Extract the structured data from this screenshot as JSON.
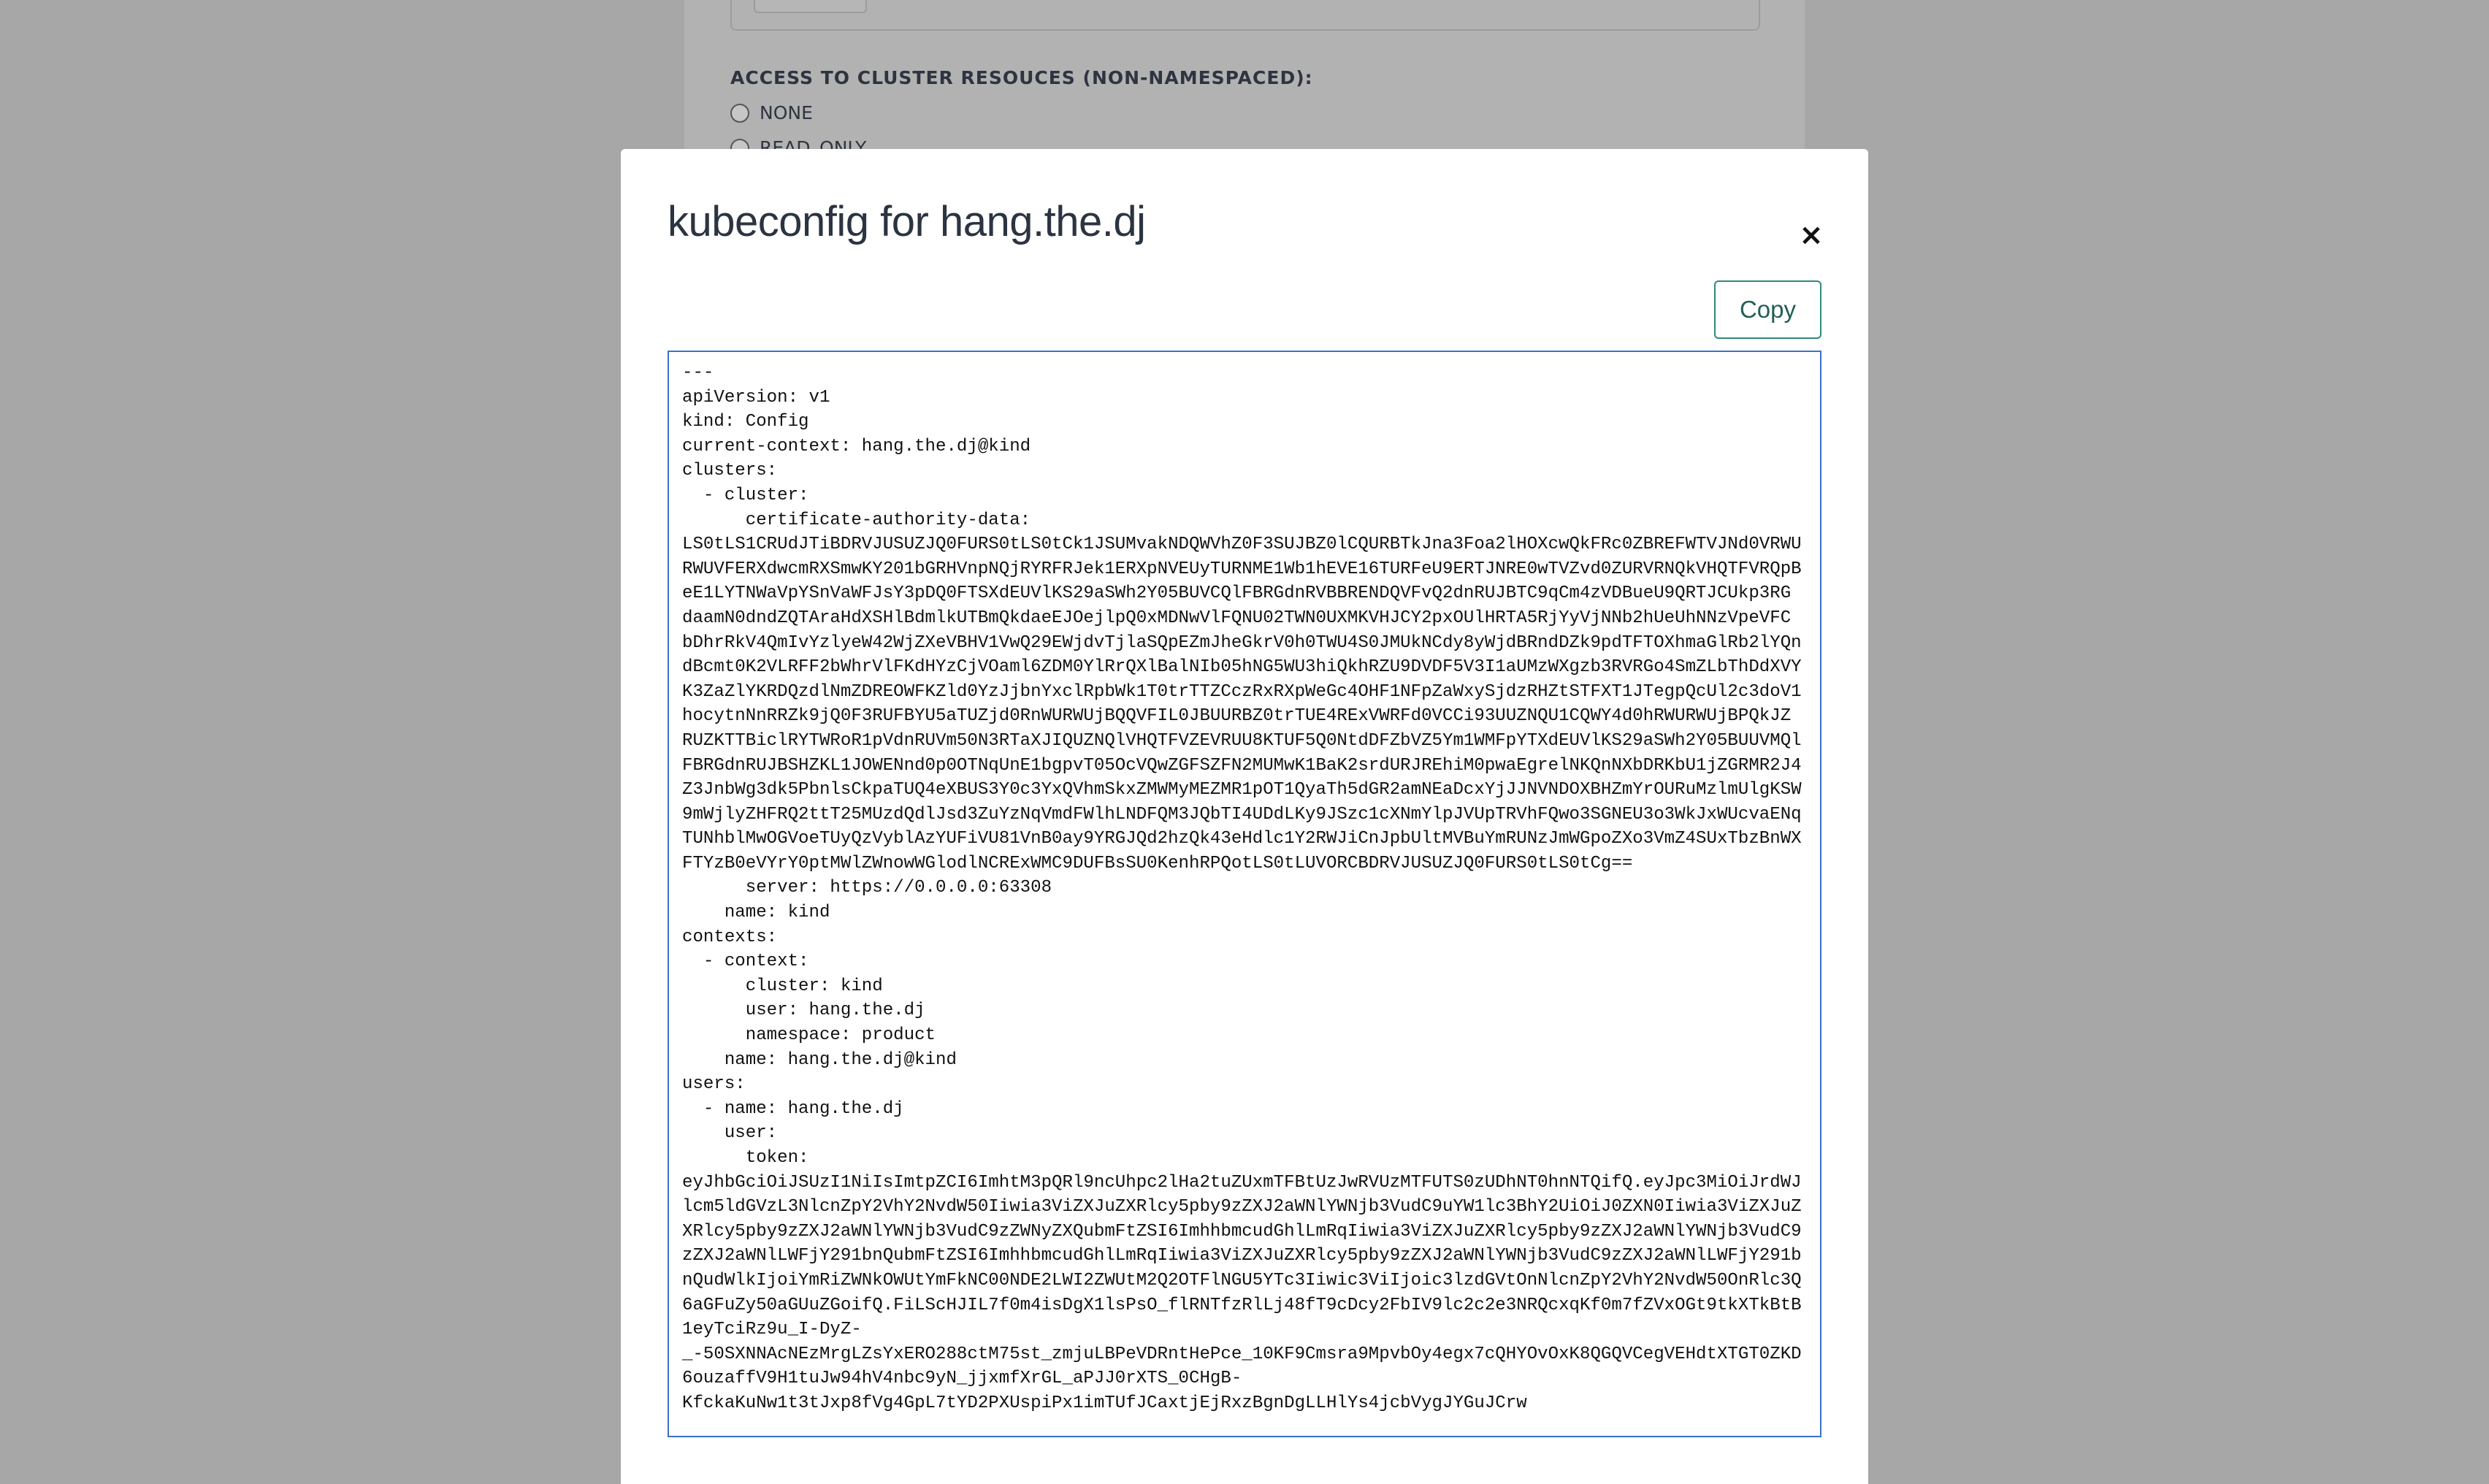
{
  "background": {
    "section_heading": "ACCESS TO CLUSTER RESOUCES (NON-NAMESPACED):",
    "options": [
      "NONE",
      "READ_ONLY"
    ]
  },
  "modal": {
    "title": "kubeconfig for hang.the.dj",
    "close_glyph": "×",
    "copy_label": "Copy",
    "kubeconfig_lines": [
      "---",
      "apiVersion: v1",
      "kind: Config",
      "current-context: hang.the.dj@kind",
      "clusters:",
      "  - cluster:",
      "      certificate-authority-data:",
      "LS0tLS1CRUdJTiBDRVJUSUZJQ0FURS0tLS0tCk1JSUMvakNDQWVhZ0F3SUJBZ0lCQURBTkJna3Foa2lHOXcwQkFRc0ZBREFWTVJNd0VRWU",
      "RWUVFERXdwcmRXSmwKY201bGRHVnpNQjRYRFRJek1ERXpNVEUyTURNME1Wb1hEVE16TURFeU9ERTJNRE0wTVZvd0ZURVRNQkVHQTFVRQpB",
      "eE1LYTNWaVpYSnVaWFJsY3pDQ0FTSXdEUVlKS29aSWh2Y05BUVCQlFBRGdnRVBBRENDQVFvQ2dnRUJBTC9qCm4zVDBueU9QRTJCUkp3RG",
      "daamN0dndZQTAraHdXSHlBdmlkUTBmQkdaeEJOejlpQ0xMDNwVlFQNU02TWN0UXMKVHJCY2pxOUlHRTA5RjYyVjNNb2hUeUhNNzVpeVFC",
      "bDhrRkV4QmIvYzlyeW42WjZXeVBHV1VwQ29EWjdvTjlaSQpEZmJheGkrV0h0TWU4S0JMUkNCdy8yWjdBRndDZk9pdTFTOXhmaGlRb2lYQn",
      "dBcmt0K2VLRFF2bWhrVlFKdHYzCjVOaml6ZDM0YlRrQXlBalNIb05hNG5WU3hiQkhRZU9DVDF5V3I1aUMzWXgzb3RVRGo4SmZLbThDdXVY",
      "K3ZaZlYKRDQzdlNmZDREOWFKZld0YzJjbnYxclRpbWk1T0trTTZCczRxRXpWeGc4OHF1NFpZaWxySjdzRHZtSTFXT1JTegpQcUl2c3doV1",
      "hocytnNnRRZk9jQ0F3RUFBYU5aTUZjd0RnWURWUjBQQVFIL0JBUURBZ0trTUE4RExVWRFd0VCCi93UUZNQU1CQWY4d0hRWURWUjBPQkJZ",
      "RUZKTTBiclRYTWRoR1pVdnRUVm50N3RTaXJIQUZNQlVHQTFVZEVRUU8KTUF5Q0NtdDFZbVZ5Ym1WMFpYTXdEUVlKS29aSWh2Y05BUUVMQl",
      "FBRGdnRUJBSHZKL1JOWENnd0p0OTNqUnE1bgpvT05OcVQwZGFSZFN2MUMwK1BaK2srdURJREhiM0pwaEgrelNKQnNXbDRKbU1jZGRMR2J4",
      "Z3JnbWg3dk5PbnlsCkpaTUQ4eXBUS3Y0c3YxQVhmSkxZMWMyMEZMR1pOT1QyaTh5dGR2amNEaDcxYjJJNVNDOXBHZmYrOURuMzlmUlgKSW",
      "9mWjlyZHFRQ2ttT25MUzdQdlJsd3ZuYzNqVmdFWlhLNDFQM3JQbTI4UDdLKy9JSzc1cXNmYlpJVUpTRVhFQwo3SGNEU3o3WkJxWUcvaENq",
      "TUNhblMwOGVoeTUyQzVyblAzYUFiVU81VnB0ay9YRGJQd2hzQk43eHdlc1Y2RWJiCnJpbUltMVBuYmRUNzJmWGpoZXo3VmZ4SUxTbzBnWX",
      "FTYzB0eVYrY0ptMWlZWnowWGlodlNCRExWMC9DUFBsSU0KenhRPQotLS0tLUVORCBDRVJUSUZJQ0FURS0tLS0tCg==",
      "      server: https://0.0.0.0:63308",
      "    name: kind",
      "contexts:",
      "  - context:",
      "      cluster: kind",
      "      user: hang.the.dj",
      "      namespace: product",
      "    name: hang.the.dj@kind",
      "users:",
      "  - name: hang.the.dj",
      "    user:",
      "      token:",
      "eyJhbGciOiJSUzI1NiIsImtpZCI6ImhtM3pQRl9ncUhpc2lHa2tuZUxmTFBtUzJwRVUzMTFUTS0zUDhNT0hnNTQifQ.eyJpc3MiOiJrdWJ",
      "lcm5ldGVzL3NlcnZpY2VhY2NvdW50Iiwia3ViZXJuZXRlcy5pby9zZXJ2aWNlYWNjb3VudC9uYW1lc3BhY2UiOiJ0ZXN0Iiwia3ViZXJuZ",
      "XRlcy5pby9zZXJ2aWNlYWNjb3VudC9zZWNyZXQubmFtZSI6ImhhbmcudGhlLmRqIiwia3ViZXJuZXRlcy5pby9zZXJ2aWNlYWNjb3VudC9",
      "zZXJ2aWNlLWFjY291bnQubmFtZSI6ImhhbmcudGhlLmRqIiwia3ViZXJuZXRlcy5pby9zZXJ2aWNlYWNjb3VudC9zZXJ2aWNlLWFjY291b",
      "nQudWlkIjoiYmRiZWNkOWUtYmFkNC00NDE2LWI2ZWUtM2Q2OTFlNGU5YTc3Iiwic3ViIjoic3lzdGVtOnNlcnZpY2VhY2NvdW50OnRlc3Q",
      "6aGFuZy50aGUuZGoifQ.FiLScHJIL7f0m4isDgX1lsPsO_flRNTfzRlLj48fT9cDcy2FbIV9lc2c2e3NRQcxqKf0m7fZVxOGt9tkXTkBtB",
      "1eyTciRz9u_I-DyZ-",
      "_-50SXNNAcNEzMrgLZsYxERO288ctM75st_zmjuLBPeVDRntHePce_10KF9Cmsra9MpvbOy4egx7cQHYOvOxK8QGQVCegVEHdtXTGT0ZKD",
      "6ouzaffV9H1tuJw94hV4nbc9yN_jjxmfXrGL_aPJJ0rXTS_0CHgB-",
      "KfckaKuNw1t3tJxp8fVg4GpL7tYD2PXUspiPx1imTUfJCaxtjEjRxzBgnDgLLHlYs4jcbVygJYGuJCrw"
    ]
  }
}
